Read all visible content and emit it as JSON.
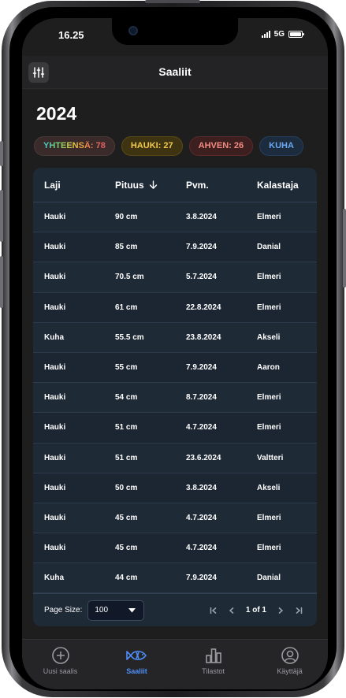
{
  "status_bar": {
    "time": "16.25",
    "network": "5G"
  },
  "app_bar": {
    "title": "Saaliit"
  },
  "year": "2024",
  "chips": [
    {
      "label": "YHTEENSÄ: 78",
      "kind": "total"
    },
    {
      "label": "HAUKI: 27",
      "kind": "hauki"
    },
    {
      "label": "AHVEN: 26",
      "kind": "ahven"
    },
    {
      "label": "KUHA",
      "kind": "kuha"
    }
  ],
  "table": {
    "headers": {
      "species": "Laji",
      "length": "Pituus",
      "date": "Pvm.",
      "angler": "Kalastaja"
    },
    "rows": [
      {
        "species": "Hauki",
        "length": "90 cm",
        "date": "3.8.2024",
        "angler": "Elmeri"
      },
      {
        "species": "Hauki",
        "length": "85 cm",
        "date": "7.9.2024",
        "angler": "Danial"
      },
      {
        "species": "Hauki",
        "length": "70.5 cm",
        "date": "5.7.2024",
        "angler": "Elmeri"
      },
      {
        "species": "Hauki",
        "length": "61 cm",
        "date": "22.8.2024",
        "angler": "Elmeri"
      },
      {
        "species": "Kuha",
        "length": "55.5 cm",
        "date": "23.8.2024",
        "angler": "Akseli"
      },
      {
        "species": "Hauki",
        "length": "55 cm",
        "date": "7.9.2024",
        "angler": "Aaron"
      },
      {
        "species": "Hauki",
        "length": "54 cm",
        "date": "8.7.2024",
        "angler": "Elmeri"
      },
      {
        "species": "Hauki",
        "length": "51 cm",
        "date": "4.7.2024",
        "angler": "Elmeri"
      },
      {
        "species": "Hauki",
        "length": "51 cm",
        "date": "23.6.2024",
        "angler": "Valtteri"
      },
      {
        "species": "Hauki",
        "length": "50 cm",
        "date": "3.8.2024",
        "angler": "Akseli"
      },
      {
        "species": "Hauki",
        "length": "45 cm",
        "date": "4.7.2024",
        "angler": "Elmeri"
      },
      {
        "species": "Hauki",
        "length": "45 cm",
        "date": "4.7.2024",
        "angler": "Elmeri"
      },
      {
        "species": "Kuha",
        "length": "44 cm",
        "date": "7.9.2024",
        "angler": "Danial"
      }
    ]
  },
  "pager": {
    "label": "Page Size:",
    "page_size": "100",
    "page_info": "1 of 1"
  },
  "tabs": [
    {
      "label": "Uusi saalis",
      "icon": "plus-circle-icon"
    },
    {
      "label": "Saaliit",
      "icon": "fish-icon"
    },
    {
      "label": "Tilastot",
      "icon": "bar-chart-icon"
    },
    {
      "label": "Käyttäjä",
      "icon": "user-icon"
    }
  ]
}
